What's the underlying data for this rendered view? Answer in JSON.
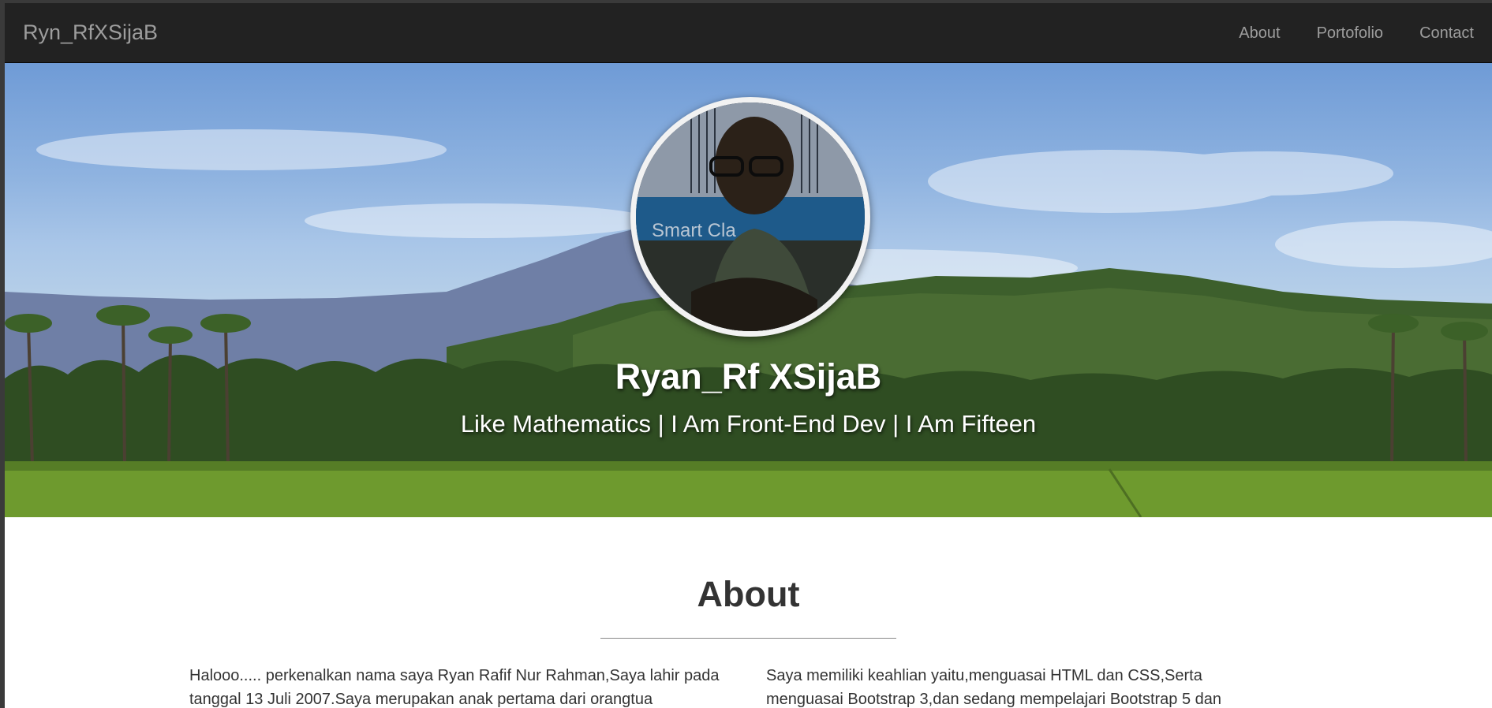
{
  "navbar": {
    "brand": "Ryn_RfXSijaB",
    "links": [
      {
        "label": "About"
      },
      {
        "label": "Portofolio"
      },
      {
        "label": "Contact"
      }
    ]
  },
  "hero": {
    "name": "Ryan_Rf XSijaB",
    "tagline": "Like Mathematics | I Am Front-End Dev | I Am Fifteen",
    "avatar_photo_text": "Smart Cla"
  },
  "about": {
    "heading": "About",
    "left_text": "Halooo..... perkenalkan nama saya Ryan Rafif Nur Rahman,Saya lahir pada tanggal 13 Juli 2007.Saya merupakan anak pertama dari orangtua",
    "right_text": "Saya memiliki keahlian yaitu,menguasai HTML dan CSS,Serta menguasai Bootstrap 3,dan sedang mempelajari Bootstrap 5 dan"
  },
  "colors": {
    "navbar_bg": "#222222",
    "nav_text": "#9d9d9d",
    "body_text": "#333333"
  }
}
